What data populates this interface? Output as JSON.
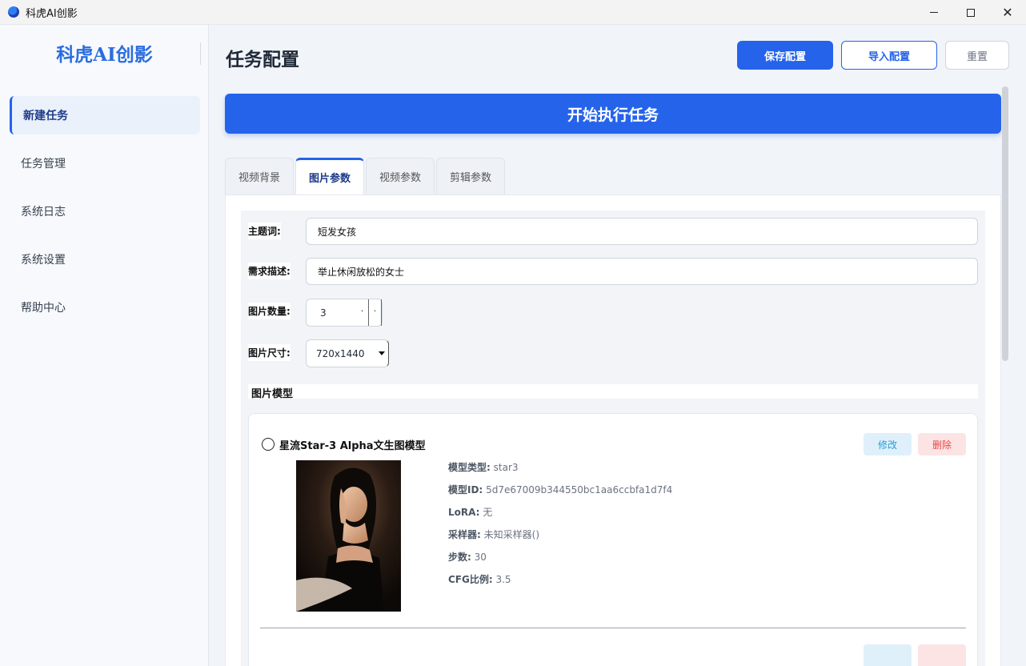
{
  "window": {
    "title": "科虎AI创影"
  },
  "sidebar": {
    "brand": "科虎AI创影",
    "items": [
      {
        "label": "新建任务",
        "active": true
      },
      {
        "label": "任务管理",
        "active": false
      },
      {
        "label": "系统日志",
        "active": false
      },
      {
        "label": "系统设置",
        "active": false
      },
      {
        "label": "帮助中心",
        "active": false
      }
    ]
  },
  "header": {
    "title": "任务配置",
    "save_label": "保存配置",
    "import_label": "导入配置",
    "reset_label": "重置"
  },
  "start_button": "开始执行任务",
  "tabs": [
    {
      "label": "视频背景",
      "active": false
    },
    {
      "label": "图片参数",
      "active": true
    },
    {
      "label": "视频参数",
      "active": false
    },
    {
      "label": "剪辑参数",
      "active": false
    }
  ],
  "form": {
    "topic": {
      "label": "主题词:",
      "value": "短发女孩"
    },
    "description": {
      "label": "需求描述:",
      "value": "举止休闲放松的女士"
    },
    "count": {
      "label": "图片数量:",
      "value": "3",
      "spin_down": "·",
      "spin_up": "·"
    },
    "size": {
      "label": "图片尺寸:",
      "value": "720x1440"
    }
  },
  "models_section": {
    "title": "图片模型",
    "models": [
      {
        "name": "星流Star-3 Alpha文生图模型",
        "edit_label": "修改",
        "delete_label": "删除",
        "fields": [
          {
            "key": "模型类型:",
            "value": "star3"
          },
          {
            "key": "模型ID:",
            "value": "5d7e67009b344550bc1aa6ccbfa1d7f4"
          },
          {
            "key": "LoRA:",
            "value": "无"
          },
          {
            "key": "采样器:",
            "value": "未知采样器()"
          },
          {
            "key": "步数:",
            "value": "30"
          },
          {
            "key": "CFG比例:",
            "value": "3.5"
          }
        ]
      }
    ]
  },
  "colors": {
    "accent": "#2563eb",
    "edit": "#2a9dd4",
    "delete": "#e5484d"
  }
}
